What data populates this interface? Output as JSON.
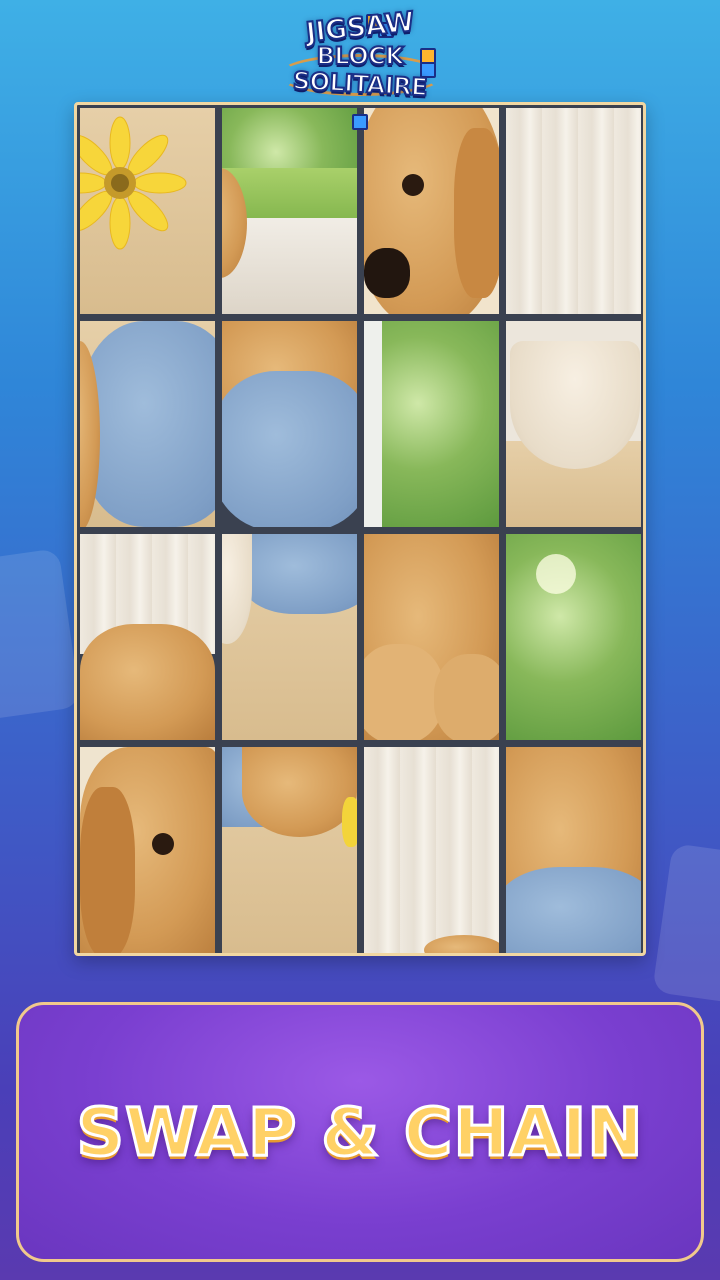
{
  "app": {
    "logo_lines": [
      "JIGSAW",
      "BLOCK",
      "SOLITAIRE"
    ]
  },
  "board": {
    "rows": 4,
    "cols": 4,
    "tiles": [
      "flower-on-table",
      "window-grass",
      "puppy-face-nose",
      "curtain",
      "blue-cushion",
      "puppy-fur-on-cushion",
      "window-trees",
      "ceramic-bowl",
      "curtain-puppy-back",
      "bowl-edge-cushion",
      "puppy-paws",
      "window-trees-bright",
      "puppy-ear-eye",
      "puppy-paw-flower",
      "curtain-floor",
      "puppy-body-cushion"
    ]
  },
  "banner": {
    "text": "SWAP & CHAIN"
  },
  "colors": {
    "background_top": "#3fb0e6",
    "background_bottom": "#5a3ab0",
    "board_frame": "#f1d7a2",
    "banner_fill": "#7a3fd0",
    "banner_text": "#ffd166"
  }
}
